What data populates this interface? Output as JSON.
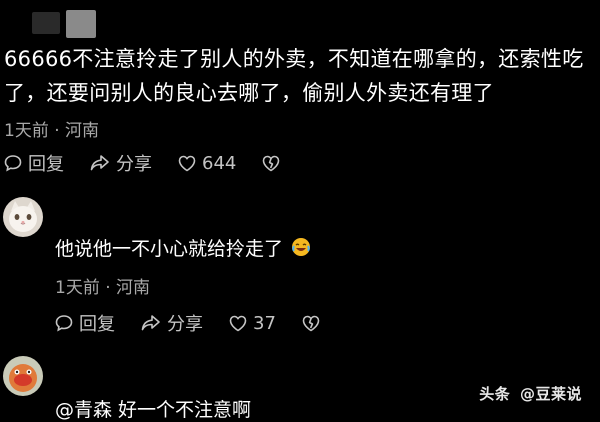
{
  "comment": {
    "text": "66666不注意拎走了别人的外卖，不知道在哪拿的，还索性吃了，还要问别人的良心去哪了，偷别人外卖还有理了",
    "time": "1天前",
    "location": "河南",
    "reply_label": "回复",
    "share_label": "分享",
    "like_count": "644"
  },
  "replies": [
    {
      "text": "他说他一不小心就给拎走了",
      "emoji": "laughing-crying-emoji",
      "time": "1天前",
      "location": "河南",
      "reply_label": "回复",
      "share_label": "分享",
      "like_count": "37"
    },
    {
      "text": "@青森  好一个不注意啊"
    }
  ],
  "separator": "·",
  "watermark": {
    "brand": "头条",
    "at": "@",
    "account": "豆莱说"
  },
  "colors": {
    "background": "#000000",
    "meta": "#a9a9a9",
    "emoji": "#f5b820"
  }
}
